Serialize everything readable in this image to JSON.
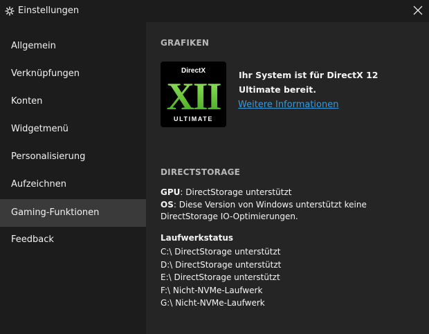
{
  "window": {
    "title": "Einstellungen"
  },
  "sidebar": {
    "items": [
      {
        "label": "Allgemein"
      },
      {
        "label": "Verknüpfungen"
      },
      {
        "label": "Konten"
      },
      {
        "label": "Widgetmenü"
      },
      {
        "label": "Personalisierung"
      },
      {
        "label": "Aufzeichnen"
      },
      {
        "label": "Gaming-Funktionen",
        "active": true
      },
      {
        "label": "Feedback"
      }
    ]
  },
  "graphics": {
    "heading": "GRAFIKEN",
    "logo_top": "DirectX",
    "logo_mark": "XII",
    "logo_bottom": "ULTIMATE",
    "status_text": "Ihr System ist für DirectX 12 Ultimate bereit.",
    "more_link": "Weitere Informationen"
  },
  "directstorage": {
    "heading": "DIRECTSTORAGE",
    "gpu_label": "GPU",
    "gpu_value": ": DirectStorage unterstützt",
    "os_label": "OS",
    "os_value": ": Diese Version von Windows unterstützt keine DirectStorage IO-Optimierungen.",
    "drive_status_title": "Laufwerkstatus",
    "drives": [
      "C:\\ DirectStorage unterstützt",
      "D:\\ DirectStorage unterstützt",
      "E:\\ DirectStorage unterstützt",
      "F:\\ Nicht-NVMe-Laufwerk",
      "G:\\ Nicht-NVMe-Laufwerk"
    ]
  },
  "colors": {
    "link": "#3a9ad9",
    "logo_green": "#5bc236",
    "active_item": "#3a3a3a"
  }
}
